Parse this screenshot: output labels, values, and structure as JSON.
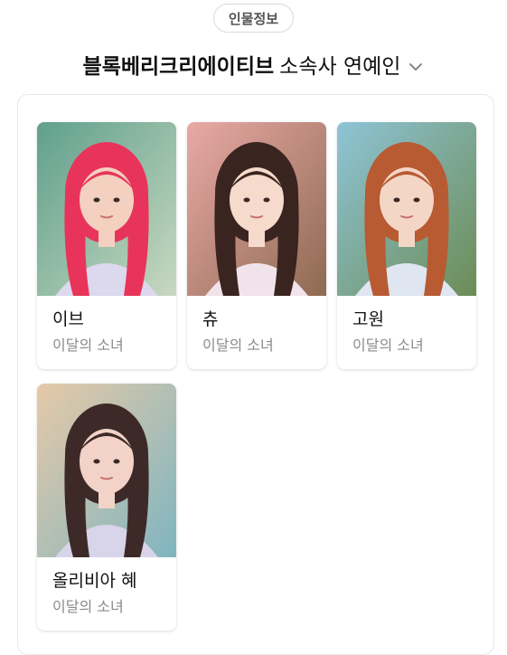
{
  "chip": {
    "label": "인물정보"
  },
  "heading": {
    "agency": "블록베리크리에이티브",
    "suffix": "소속사 연예인"
  },
  "artists": [
    {
      "name": "이브",
      "group": "이달의 소녀",
      "palette": {
        "bg": "#5fa08c",
        "bg2": "#c8d8c0",
        "hair": "#e8345a",
        "skin": "#f4d0c0",
        "cloth": "#dcd8ee"
      }
    },
    {
      "name": "츄",
      "group": "이달의 소녀",
      "palette": {
        "bg": "#e9a9a6",
        "bg2": "#8e6a52",
        "hair": "#3a2420",
        "skin": "#f6dacb",
        "cloth": "#f1e3ea"
      }
    },
    {
      "name": "고원",
      "group": "이달의 소녀",
      "palette": {
        "bg": "#8ec4d6",
        "bg2": "#6c8c56",
        "hair": "#b85a32",
        "skin": "#f4d6c6",
        "cloth": "#dfe6f2"
      }
    },
    {
      "name": "올리비아 혜",
      "group": "이달의 소녀",
      "palette": {
        "bg": "#e6c9a8",
        "bg2": "#7fb5c0",
        "hair": "#3d2a28",
        "skin": "#f3d3c8",
        "cloth": "#d8d4ea"
      }
    }
  ]
}
